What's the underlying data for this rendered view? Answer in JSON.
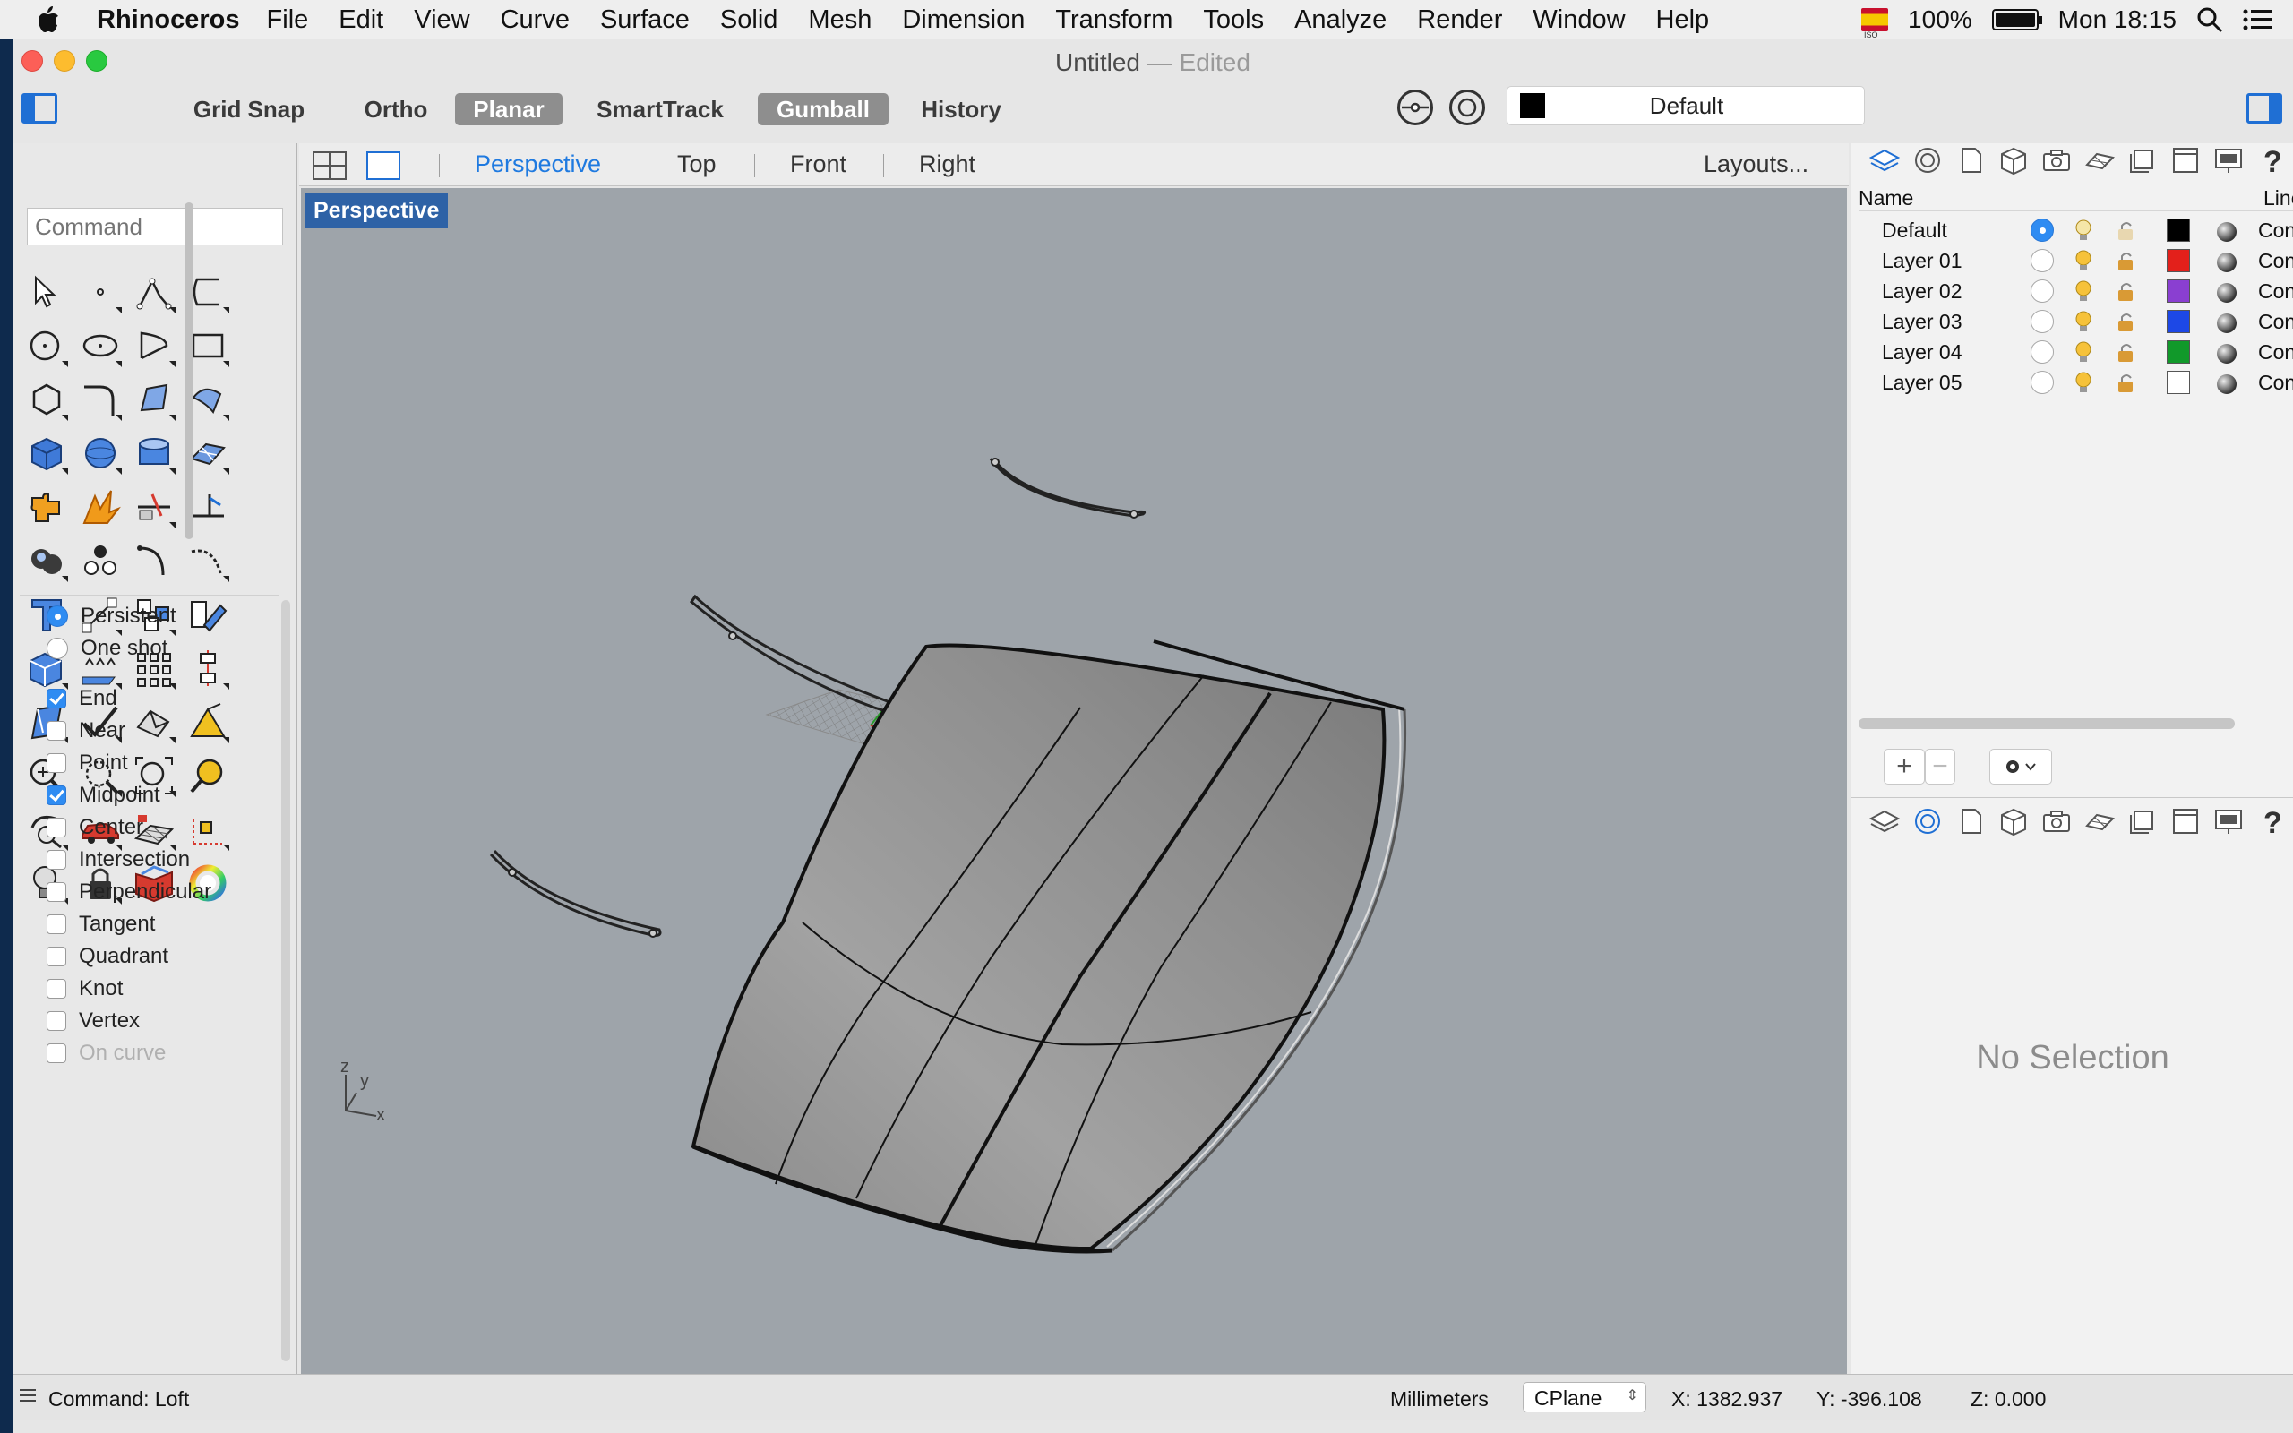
{
  "menubar": {
    "app_name": "Rhinoceros",
    "items": [
      "File",
      "Edit",
      "View",
      "Curve",
      "Surface",
      "Solid",
      "Mesh",
      "Dimension",
      "Transform",
      "Tools",
      "Analyze",
      "Render",
      "Window",
      "Help"
    ],
    "battery": "100%",
    "clock": "Mon 18:15"
  },
  "window": {
    "title": "Untitled",
    "title_suffix": "— Edited"
  },
  "toolbar": {
    "grid_snap": "Grid Snap",
    "ortho": "Ortho",
    "planar": "Planar",
    "smarttrack": "SmartTrack",
    "gumball": "Gumball",
    "history": "History",
    "current_layer": "Default"
  },
  "left_panel": {
    "command_placeholder": "Command",
    "snap_mode": [
      "Persistent",
      "One shot"
    ],
    "osnaps": [
      {
        "label": "End",
        "checked": true
      },
      {
        "label": "Near",
        "checked": false
      },
      {
        "label": "Point",
        "checked": false
      },
      {
        "label": "Midpoint",
        "checked": true
      },
      {
        "label": "Center",
        "checked": false
      },
      {
        "label": "Intersection",
        "checked": false
      },
      {
        "label": "Perpendicular",
        "checked": false
      },
      {
        "label": "Tangent",
        "checked": false
      },
      {
        "label": "Quadrant",
        "checked": false
      },
      {
        "label": "Knot",
        "checked": false
      },
      {
        "label": "Vertex",
        "checked": false
      },
      {
        "label": "On curve",
        "checked": false
      }
    ]
  },
  "viewport_tabs": {
    "tabs": [
      "Perspective",
      "Top",
      "Front",
      "Right"
    ],
    "layouts": "Layouts..."
  },
  "viewport": {
    "label": "Perspective",
    "axis_labels": {
      "z": "z",
      "y": "y",
      "x": "x"
    }
  },
  "layers_panel": {
    "col_name": "Name",
    "col_linetype": "Linety",
    "layers": [
      {
        "name": "Default",
        "color": "#000000",
        "linetype": "Cont",
        "current": true
      },
      {
        "name": "Layer 01",
        "color": "#e3201b",
        "linetype": "Cont",
        "current": false
      },
      {
        "name": "Layer 02",
        "color": "#8a3fd1",
        "linetype": "Cont",
        "current": false
      },
      {
        "name": "Layer 03",
        "color": "#1d48e6",
        "linetype": "Cont",
        "current": false
      },
      {
        "name": "Layer 04",
        "color": "#11992a",
        "linetype": "Cont",
        "current": false
      },
      {
        "name": "Layer 05",
        "color": "#ffffff",
        "linetype": "Cont",
        "current": false
      }
    ],
    "add": "+",
    "remove": "−",
    "no_selection": "No Selection"
  },
  "statusbar": {
    "command": "Command: Loft",
    "units": "Millimeters",
    "cplane": "CPlane",
    "x": "X: 1382.937",
    "y": "Y: -396.108",
    "z": "Z: 0.000"
  },
  "colors": {
    "accent": "#2f8cf2",
    "viewport_bg": "#9ea4aa",
    "viewport_label_bg": "#2e62a6"
  }
}
